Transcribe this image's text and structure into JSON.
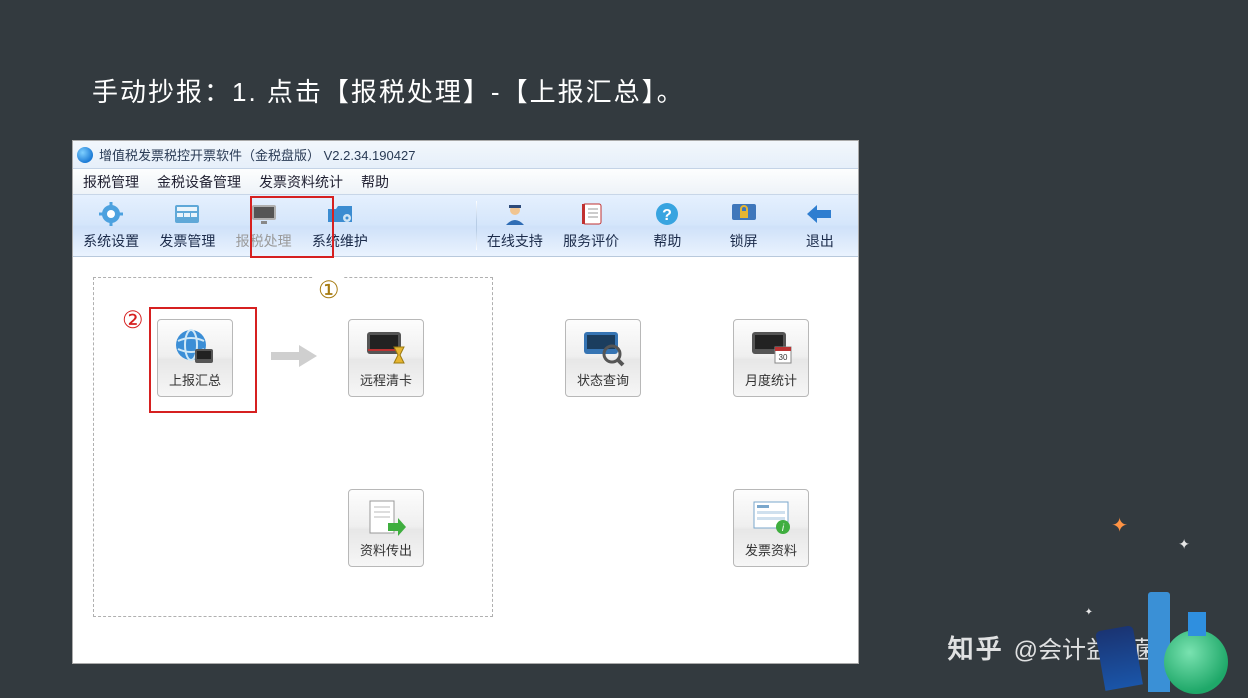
{
  "instruction": "手动抄报：1. 点击【报税处理】-【上报汇总】。",
  "window": {
    "title": "增值税发票税控开票软件（金税盘版）  V2.2.34.190427"
  },
  "menubar": [
    "报税管理",
    "金税设备管理",
    "发票资料统计",
    "帮助"
  ],
  "toolbar": {
    "left": [
      {
        "key": "system-settings",
        "label": "系统设置"
      },
      {
        "key": "invoice-mgmt",
        "label": "发票管理"
      },
      {
        "key": "tax-process",
        "label": "报税处理",
        "disabled": true
      },
      {
        "key": "system-maint",
        "label": "系统维护"
      }
    ],
    "right": [
      {
        "key": "online-support",
        "label": "在线支持"
      },
      {
        "key": "service-rating",
        "label": "服务评价"
      },
      {
        "key": "help",
        "label": "帮助"
      },
      {
        "key": "lock",
        "label": "锁屏"
      },
      {
        "key": "exit",
        "label": "退出"
      }
    ]
  },
  "annotations": {
    "a": "①",
    "b": "②"
  },
  "tiles": {
    "report_summary": "上报汇总",
    "remote_clear": "远程清卡",
    "status_query": "状态查询",
    "monthly_stats": "月度统计",
    "data_export": "资料传出",
    "invoice_data": "发票资料"
  },
  "watermark": {
    "logo": "知乎",
    "author": "@会计益生菌"
  }
}
